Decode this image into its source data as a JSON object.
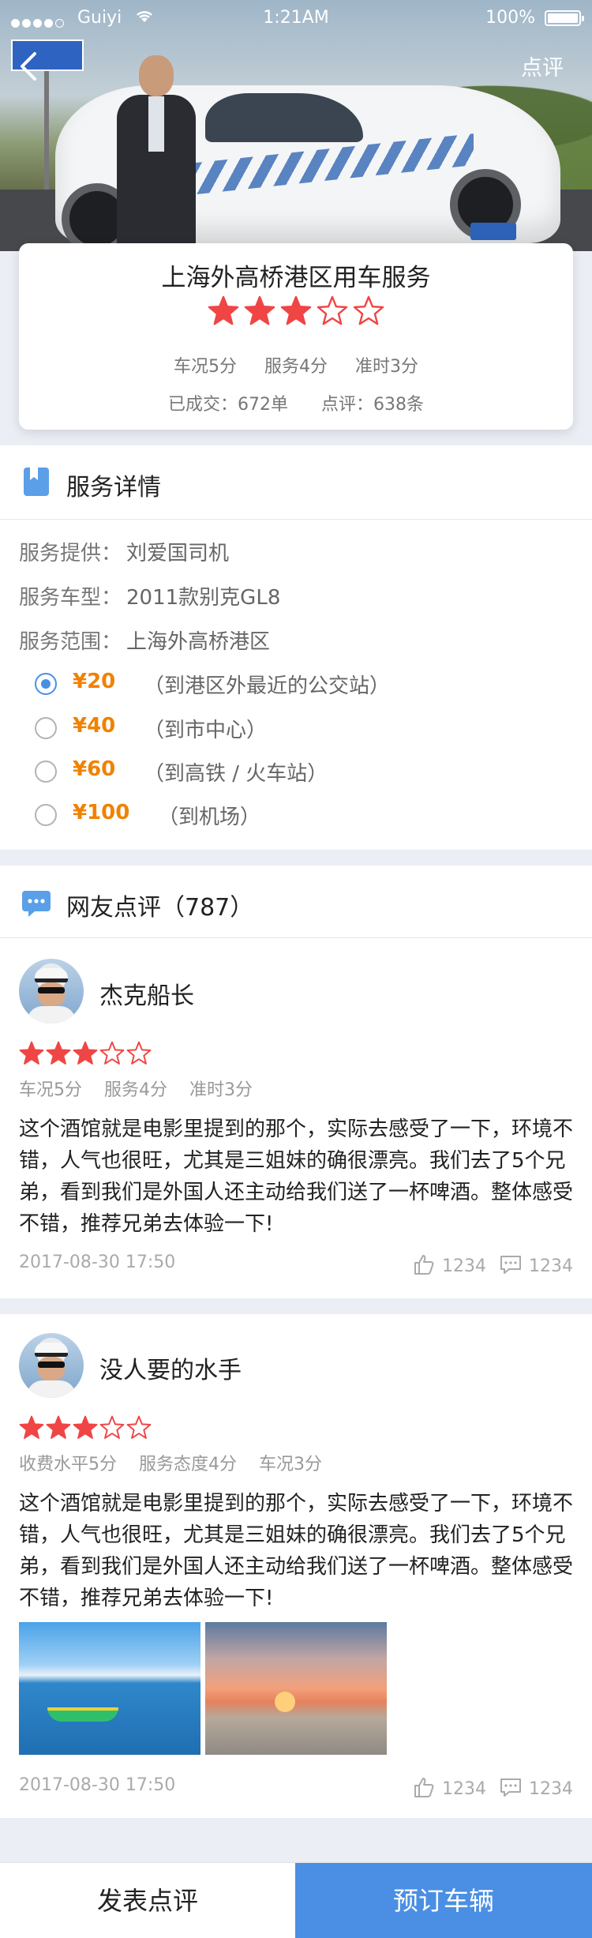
{
  "status_bar": {
    "carrier": "Guiyi",
    "time": "1:21AM",
    "battery": "100%"
  },
  "nav": {
    "right_link": "点评"
  },
  "service": {
    "title": "上海外高桥港区用车服务",
    "rating": 3,
    "rating_max": 5,
    "scores": [
      "车况5分",
      "服务4分",
      "准时3分"
    ],
    "orders": "已成交：672单",
    "reviews_count": "点评：638条"
  },
  "details": {
    "section_title": "服务详情",
    "provider_label": "服务提供：",
    "provider": "刘爱国司机",
    "car_label": "服务车型：",
    "car": "2011款别克GL8",
    "range_label": "服务范围：",
    "range": "上海外高桥港区",
    "options": [
      {
        "price": "¥20",
        "desc": "（到港区外最近的公交站）",
        "selected": true
      },
      {
        "price": "¥40",
        "desc": "（到市中心）",
        "selected": false
      },
      {
        "price": "¥60",
        "desc": "（到高铁 / 火车站）",
        "selected": false
      },
      {
        "price": "¥100",
        "desc": "（到机场）",
        "selected": false
      }
    ]
  },
  "reviews_section": {
    "title": "网友点评（787）"
  },
  "reviews": [
    {
      "name": "杰克船长",
      "rating": 3,
      "scores": [
        "车况5分",
        "服务4分",
        "准时3分"
      ],
      "text": "这个酒馆就是电影里提到的那个，实际去感受了一下，环境不错，人气也很旺，尤其是三姐妹的确很漂亮。我们去了5个兄弟，看到我们是外国人还主动给我们送了一杯啤酒。整体感受不错，推荐兄弟去体验一下!",
      "date": "2017-08-30   17:50",
      "likes": "1234",
      "comments": "1234"
    },
    {
      "name": "没人要的水手",
      "rating": 3,
      "scores": [
        "收费水平5分",
        "服务态度4分",
        "车况3分"
      ],
      "text": "这个酒馆就是电影里提到的那个，实际去感受了一下，环境不错，人气也很旺，尤其是三姐妹的确很漂亮。我们去了5个兄弟，看到我们是外国人还主动给我们送了一杯啤酒。整体感受不错，推荐兄弟去体验一下!",
      "date": "2017-08-30   17:50",
      "likes": "1234",
      "comments": "1234"
    }
  ],
  "bottom": {
    "left": "发表点评",
    "right": "预订车辆"
  },
  "colors": {
    "accent": "#4a8fe4",
    "star": "#f04545",
    "price": "#f08200"
  }
}
